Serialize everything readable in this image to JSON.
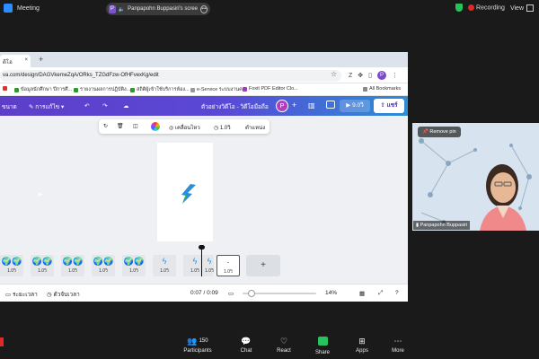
{
  "topbar": {
    "meeting_label": "Meeting",
    "share_banner": "Panpapohn Buppasiri's scree",
    "recording_label": "Recording",
    "view_label": "View",
    "avatar_initial": "P"
  },
  "browser": {
    "tab_label": "ดีโอ",
    "tab_close": "×",
    "new_tab": "+",
    "url": "va.com/design/DAGVkemeZqA/ORks_TZGdFzw-OfHFvexKg/edit",
    "profile_initial": "P",
    "bookmarks": [
      "ข้อมูลนักศึกษา ปีการศึ...",
      "รายงานผลการปฏิบัติง...",
      "สถิติผู้เข้าใช้บริการห้อง...",
      "e-Service ระบบงานค...",
      "Foxit PDF Editor Clo...",
      "All Bookmarks"
    ]
  },
  "canva": {
    "toolbar": {
      "menu_label": "ขนาด",
      "edit_label": "การแก้ไข",
      "doc_title": "ตัวอย่างวิดีโอ - วิดีโอมือถือ",
      "avatar_initial": "P",
      "present_label": "9.0วิ",
      "share_label": "แชร์"
    },
    "float_toolbar": {
      "animate_label": "เคลื่อนไหว",
      "duration_label": "1.0วิ",
      "position_label": "ตำแหน่ง"
    },
    "thumbnails": [
      {
        "duration": "1.0วิ"
      },
      {
        "duration": "1.0วิ"
      },
      {
        "duration": "1.0วิ"
      },
      {
        "duration": "1.0วิ"
      },
      {
        "duration": "1.0วิ"
      },
      {
        "duration": "1.0วิ"
      },
      {
        "duration": "1.0วิ"
      },
      {
        "duration": "1.0วิ"
      },
      {
        "duration": "1.0วิ"
      }
    ],
    "add_page": "+",
    "bottom_bar": {
      "notes_label": "ระยะเวลา",
      "timer_label": "ตัวจับเวลา",
      "time_readout": "0:07 / 0:09",
      "zoom_level": "14%"
    }
  },
  "video": {
    "remove_pin": "Remove pin",
    "participant_name": "Panpapohn Buppasiri"
  },
  "zoombar": {
    "participants_label": "Participants",
    "participants_count": "150",
    "chat_label": "Chat",
    "react_label": "React",
    "share_label": "Share",
    "apps_label": "Apps",
    "more_label": "More"
  }
}
